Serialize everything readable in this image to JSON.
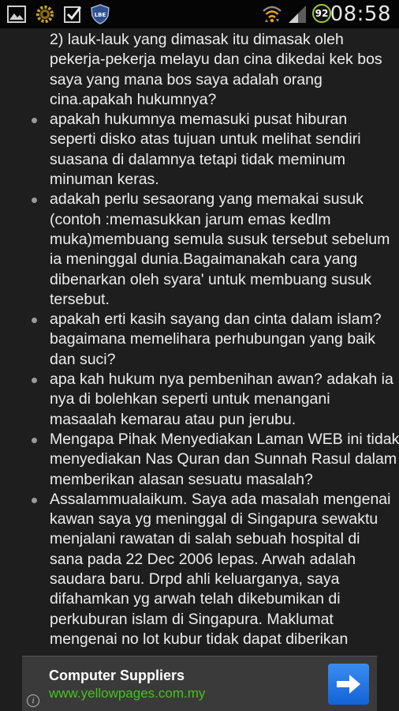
{
  "status_bar": {
    "time": "08:58",
    "battery": "92",
    "icons": [
      "gallery-icon",
      "settings-gear-icon",
      "checkbox-icon",
      "lbe-shield-icon",
      "wifi-icon",
      "signal-icon"
    ],
    "lbe_label": "LBE"
  },
  "content": {
    "items": [
      {
        "bullet": false,
        "lines": [
          "2) lauk-lauk yang dimasak itu dimasak oleh",
          "pekerja-pekerja melayu dan cina dikedai kek bos",
          "saya yang mana bos saya adalah orang",
          "cina.apakah hukumnya?"
        ]
      },
      {
        "bullet": true,
        "lines": [
          "apakah hukumnya memasuki pusat hiburan",
          "seperti disko atas tujuan untuk melihat sendiri",
          "suasana di dalamnya tetapi tidak meminum",
          "minuman keras."
        ]
      },
      {
        "bullet": true,
        "lines": [
          "adakah perlu sesaorang yang memakai susuk",
          "(contoh :memasukkan jarum emas kedlm",
          "muka)membuang semula susuk tersebut sebelum",
          "ia meninggal dunia.Bagaimanakah cara yang",
          "dibenarkan oleh syara' untuk membuang susuk",
          "tersebut."
        ]
      },
      {
        "bullet": true,
        "lines": [
          "apakah erti kasih sayang dan cinta dalam islam?",
          "bagaimana memelihara perhubungan yang baik",
          "dan suci?"
        ]
      },
      {
        "bullet": true,
        "lines": [
          "apa kah hukum nya pembenihan awan? adakah ia",
          "nya di bolehkan seperti untuk menangani",
          "masaalah kemarau atau pun jerubu."
        ]
      },
      {
        "bullet": true,
        "lines": [
          "Mengapa Pihak Menyediakan Laman WEB ini tidak",
          "menyediakan Nas Quran dan Sunnah Rasul dalam",
          "memberikan alasan sesuatu masalah?"
        ]
      },
      {
        "bullet": true,
        "lines": [
          "Assalammualaikum. Saya ada masalah mengenai",
          "kawan saya yg meninggal di Singapura sewaktu",
          "menjalani rawatan di salah sebuah hospital di",
          "sana pada 22 Dec 2006 lepas. Arwah adalah",
          "saudara baru. Drpd ahli keluarganya, saya",
          "difahamkan yg arwah telah dikebumikan di",
          "perkuburan islam di Singapura. Maklumat",
          "mengenai no lot kubur tidak dapat diberikan"
        ]
      }
    ]
  },
  "ad": {
    "title": "Computer Suppliers",
    "url": "www.yellowpages.com.my",
    "info_label": "i"
  },
  "colors": {
    "background": "#1e1e1e",
    "text": "#ededed",
    "ad_url": "#45c21e",
    "ad_button": "#1f6fe0",
    "battery_ring": "#9acd32"
  }
}
